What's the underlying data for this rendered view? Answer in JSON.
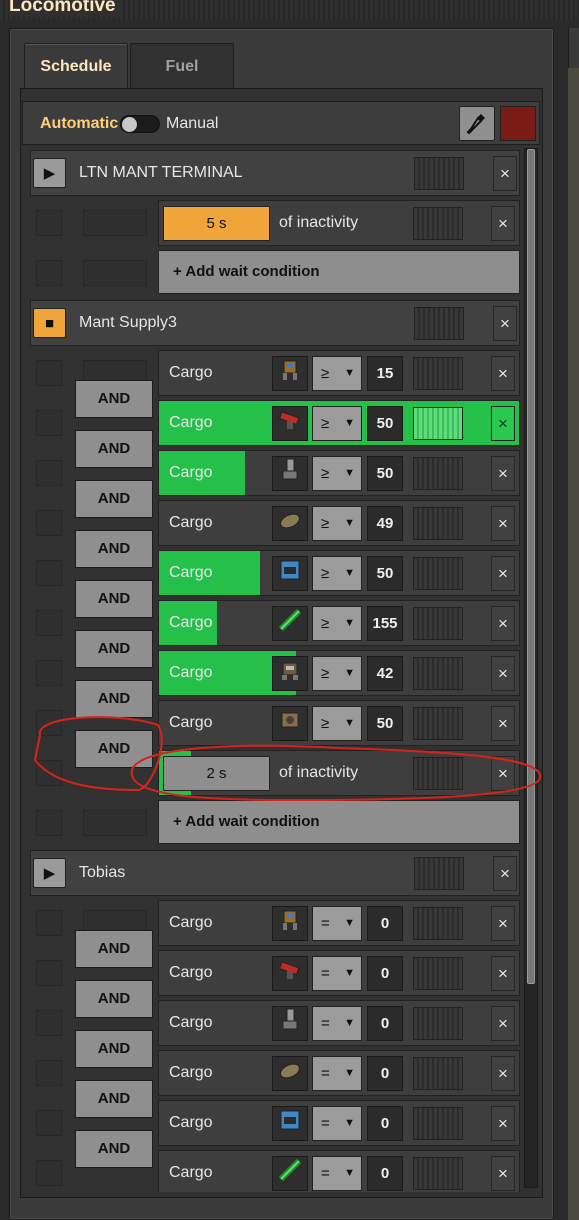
{
  "window": {
    "title": "Locomotive"
  },
  "tabs": [
    {
      "label": "Schedule",
      "active": true
    },
    {
      "label": "Fuel",
      "active": false
    }
  ],
  "mode": {
    "automatic_label": "Automatic",
    "manual_label": "Manual",
    "color": "#7b1b16"
  },
  "icons": {
    "play": "play-icon",
    "stop": "stop-icon",
    "close": "close-icon",
    "picker": "color-picker-icon"
  },
  "and_label": "AND",
  "add_condition_label": "+ Add wait condition",
  "stations": [
    {
      "name": "LTN MANT TERMINAL",
      "state": "play",
      "conditions": [
        {
          "type": "inactivity",
          "time": "5 s",
          "text": "of inactivity",
          "highlight": true,
          "progress": 0
        }
      ],
      "show_add": true
    },
    {
      "name": "Mant Supply3",
      "state": "current",
      "conditions": [
        {
          "type": "cargo",
          "label": "Cargo",
          "icon": "logistic-robot",
          "cmp": "≥",
          "value": "15",
          "progress": 0
        },
        {
          "type": "cargo",
          "label": "Cargo",
          "icon": "rocket-launcher",
          "cmp": "≥",
          "value": "50",
          "progress": 1.0,
          "satisfied": true
        },
        {
          "type": "cargo",
          "label": "Cargo",
          "icon": "pipe-to-ground",
          "cmp": "≥",
          "value": "50",
          "progress": 0.24
        },
        {
          "type": "cargo",
          "label": "Cargo",
          "icon": "stone-brick",
          "cmp": "≥",
          "value": "49",
          "progress": 0
        },
        {
          "type": "cargo",
          "label": "Cargo",
          "icon": "chest",
          "cmp": "≥",
          "value": "50",
          "progress": 0.28
        },
        {
          "type": "cargo",
          "label": "Cargo",
          "icon": "rail",
          "cmp": "≥",
          "value": "155",
          "progress": 0.16
        },
        {
          "type": "cargo",
          "label": "Cargo",
          "icon": "construction-robot",
          "cmp": "≥",
          "value": "42",
          "progress": 0.38
        },
        {
          "type": "cargo",
          "label": "Cargo",
          "icon": "assembler",
          "cmp": "≥",
          "value": "50",
          "progress": 0
        },
        {
          "type": "inactivity",
          "time": "2 s",
          "text": "of inactivity",
          "highlight": false,
          "progress": 0.09
        }
      ],
      "show_add": true
    },
    {
      "name": "Tobias",
      "state": "play",
      "conditions": [
        {
          "type": "cargo",
          "label": "Cargo",
          "icon": "logistic-robot",
          "cmp": "=",
          "value": "0",
          "progress": 0
        },
        {
          "type": "cargo",
          "label": "Cargo",
          "icon": "rocket-launcher",
          "cmp": "=",
          "value": "0",
          "progress": 0
        },
        {
          "type": "cargo",
          "label": "Cargo",
          "icon": "pipe-to-ground",
          "cmp": "=",
          "value": "0",
          "progress": 0
        },
        {
          "type": "cargo",
          "label": "Cargo",
          "icon": "stone-brick",
          "cmp": "=",
          "value": "0",
          "progress": 0
        },
        {
          "type": "cargo",
          "label": "Cargo",
          "icon": "chest",
          "cmp": "=",
          "value": "0",
          "progress": 0
        },
        {
          "type": "cargo",
          "label": "Cargo",
          "icon": "rail",
          "cmp": "=",
          "value": "0",
          "progress": 0
        }
      ],
      "show_add": false
    }
  ]
}
